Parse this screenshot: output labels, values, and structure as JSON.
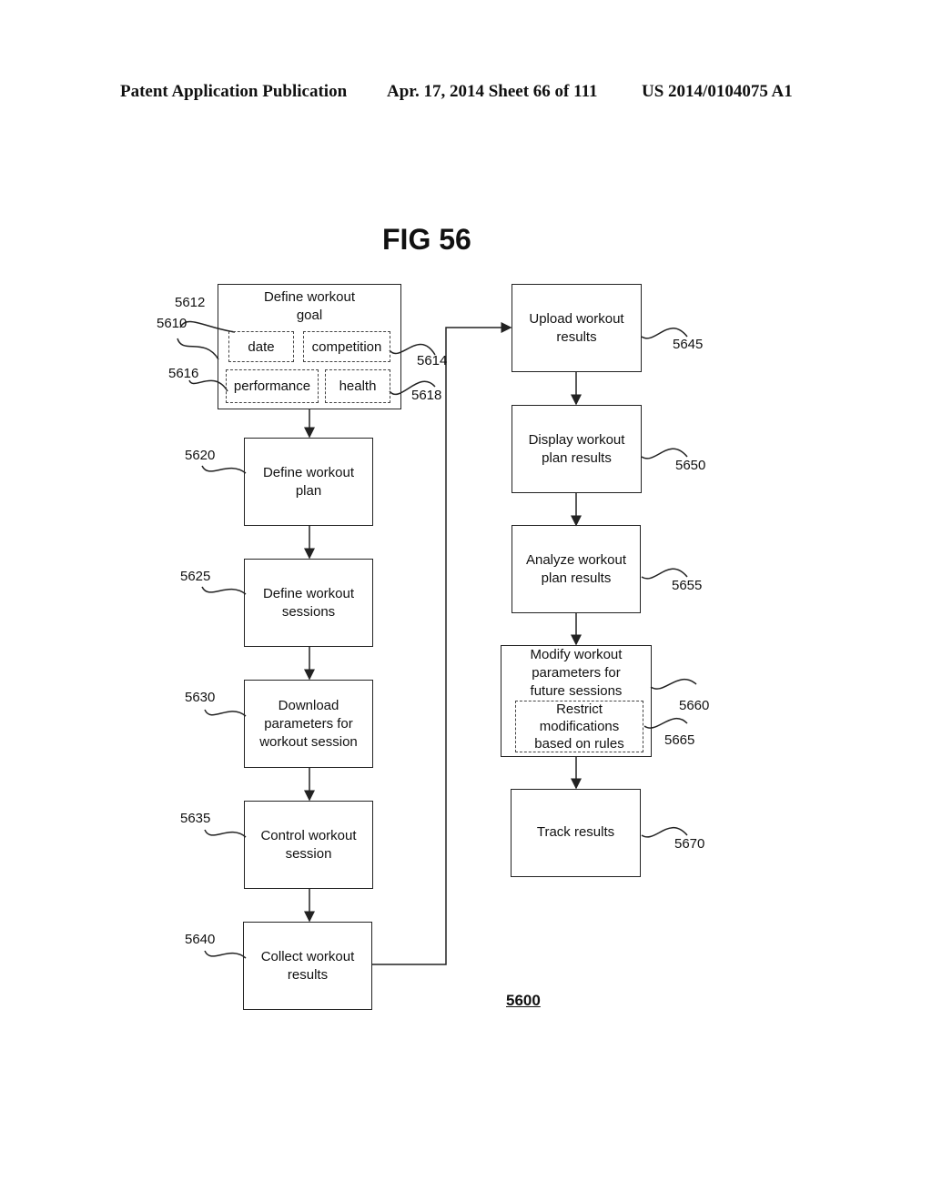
{
  "header": {
    "publication": "Patent Application Publication",
    "date_sheet": "Apr. 17, 2014  Sheet 66 of 111",
    "patent_number": "US 2014/0104075 A1"
  },
  "figure": {
    "title": "FIG 56",
    "id": "5600",
    "goal_box": {
      "label": "Define workout\ngoal",
      "ref": "5610",
      "sub": [
        {
          "label": "date",
          "ref": "5612"
        },
        {
          "label": "competition",
          "ref": "5614"
        },
        {
          "label": "performance",
          "ref": "5616"
        },
        {
          "label": "health",
          "ref": "5618"
        }
      ]
    },
    "left_steps": [
      {
        "label": "Define workout\nplan",
        "ref": "5620"
      },
      {
        "label": "Define workout\nsessions",
        "ref": "5625"
      },
      {
        "label": "Download\nparameters for\nworkout session",
        "ref": "5630"
      },
      {
        "label": "Control workout\nsession",
        "ref": "5635"
      },
      {
        "label": "Collect workout\nresults",
        "ref": "5640"
      }
    ],
    "right_steps": [
      {
        "label": "Upload workout\nresults",
        "ref": "5645"
      },
      {
        "label": "Display workout\nplan results",
        "ref": "5650"
      },
      {
        "label": "Analyze workout\nplan results",
        "ref": "5655"
      },
      {
        "label": "Modify workout\nparameters for\nfuture sessions",
        "ref": "5660"
      },
      {
        "label": "Track results",
        "ref": "5670"
      }
    ],
    "sub_step": {
      "label": "Restrict\nmodifications\nbased on rules",
      "ref": "5665"
    }
  }
}
